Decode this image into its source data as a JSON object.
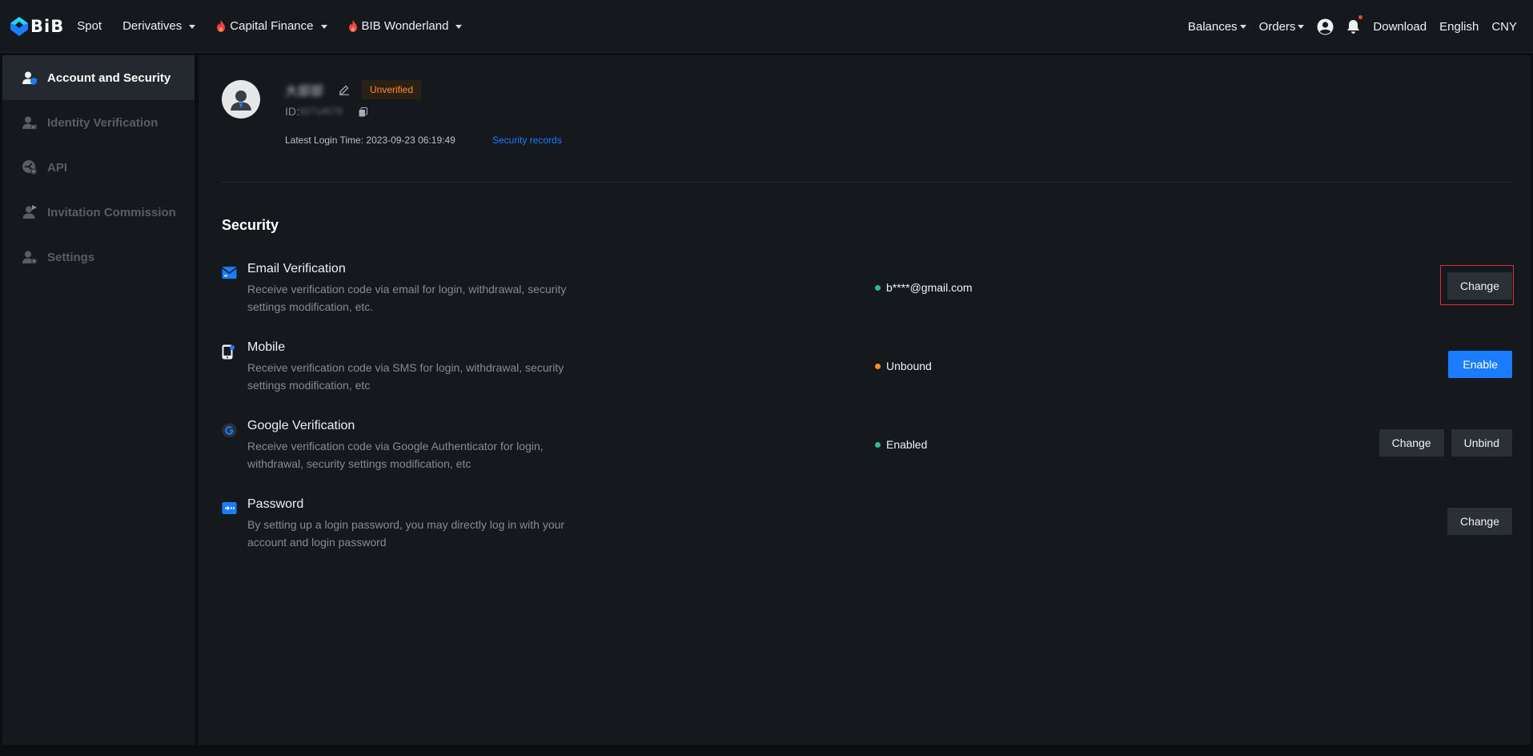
{
  "brand": {
    "logo_text": "BiB",
    "accent": "#1a7cff"
  },
  "topnav": {
    "items": [
      {
        "label": "Spot",
        "has_caret": false,
        "fire": false
      },
      {
        "label": "Derivatives",
        "has_caret": true,
        "fire": false
      },
      {
        "label": "Capital Finance",
        "has_caret": true,
        "fire": true
      },
      {
        "label": "BIB Wonderland",
        "has_caret": true,
        "fire": true
      }
    ],
    "right": {
      "balances": "Balances",
      "orders": "Orders",
      "download": "Download",
      "language": "English",
      "currency": "CNY"
    }
  },
  "sidebar": {
    "items": [
      {
        "label": "Account and Security",
        "active": true,
        "icon": "user-shield-icon"
      },
      {
        "label": "Identity Verification",
        "active": false,
        "icon": "id-user-icon"
      },
      {
        "label": "API",
        "active": false,
        "icon": "api-icon"
      },
      {
        "label": "Invitation Commission",
        "active": false,
        "icon": "invite-user-icon"
      },
      {
        "label": "Settings",
        "active": false,
        "icon": "settings-user-icon"
      }
    ]
  },
  "profile": {
    "username": "大部部",
    "status_badge": "Unverified",
    "id_label": "ID:",
    "id_value": "92714578",
    "login_time": "Latest Login Time: 2023-09-23 06:19:49",
    "security_records": "Security records"
  },
  "security": {
    "title": "Security",
    "rows": [
      {
        "title": "Email Verification",
        "desc": "Receive verification code via email for login, withdrawal, security settings modification, etc.",
        "status": "b****@gmail.com",
        "status_color": "#2ebd85",
        "buttons": [
          {
            "label": "Change",
            "primary": false
          }
        ]
      },
      {
        "title": "Mobile",
        "desc": "Receive verification code via SMS for login, withdrawal, security settings modification, etc",
        "status": "Unbound",
        "status_color": "#ff8f1f",
        "buttons": [
          {
            "label": "Enable",
            "primary": true
          }
        ]
      },
      {
        "title": "Google Verification",
        "desc": "Receive verification code via Google Authenticator for login, withdrawal, security settings modification, etc",
        "status": "Enabled",
        "status_color": "#2ebd85",
        "buttons": [
          {
            "label": "Change",
            "primary": false
          },
          {
            "label": "Unbind",
            "primary": false
          }
        ]
      },
      {
        "title": "Password",
        "desc": "By setting up a login password, you may directly log in with your account and login password",
        "status": "",
        "status_color": "",
        "buttons": [
          {
            "label": "Change",
            "primary": false
          }
        ]
      }
    ]
  }
}
